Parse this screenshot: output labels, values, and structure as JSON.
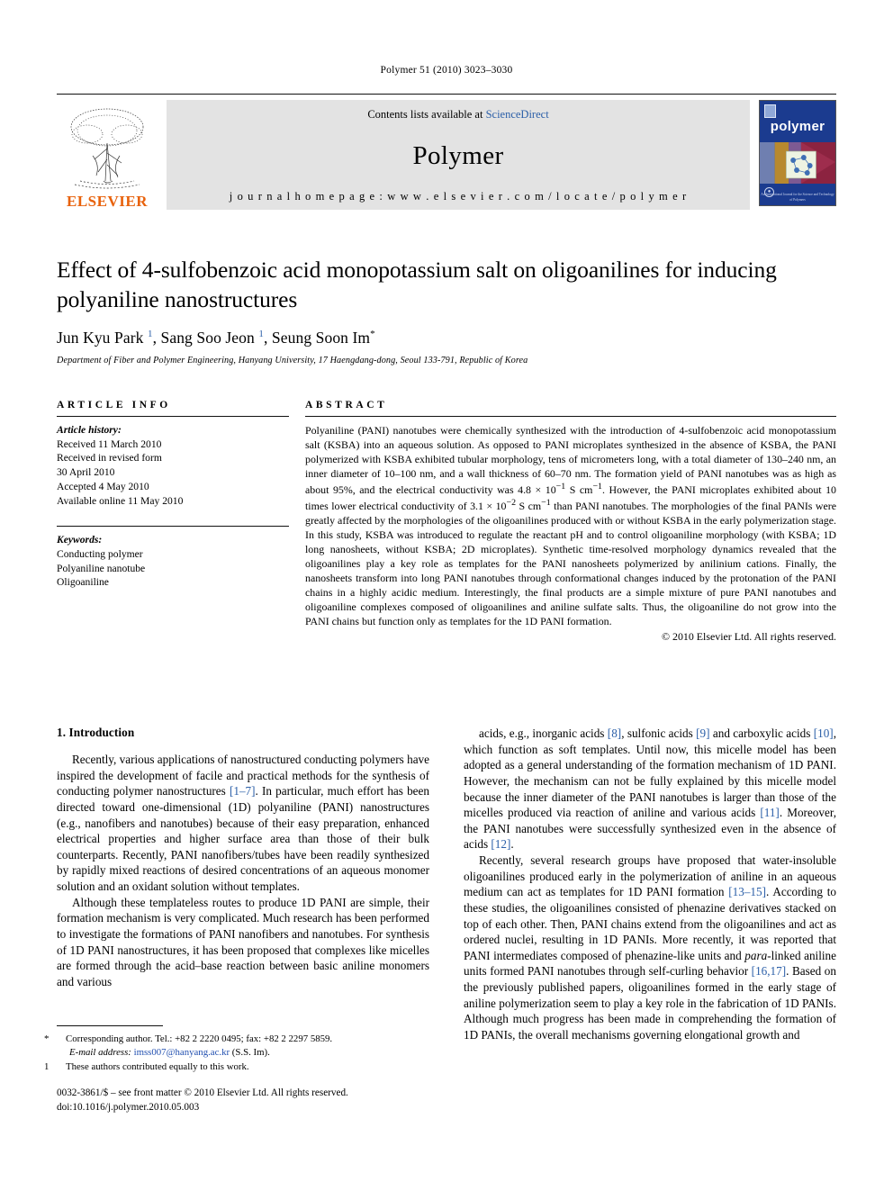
{
  "running_head": "Polymer 51 (2010) 3023–3030",
  "masthead": {
    "contents_prefix": "Contents lists available at ",
    "sciencedirect": "ScienceDirect",
    "journal_title": "Polymer",
    "homepage": "j o u r n a l   h o m e p a g e :   w w w . e l s e v i e r . c o m / l o c a t e / p o l y m e r",
    "publisher": "ELSEVIER",
    "cover_title": "polymer",
    "cover_footer": "An International Journal for the Science and Technology of Polymers",
    "accent_blue": "#2b5fa8",
    "elsevier_orange": "#E8620C",
    "cover_blue": "#1b3b8f"
  },
  "article": {
    "title": "Effect of 4-sulfobenzoic acid monopotassium salt on oligoanilines for inducing polyaniline nanostructures",
    "authors_html": "Jun Kyu Park <sup>1</sup>, Sang Soo Jeon <sup>1</sup>, Seung Soon Im<sup class=\"star\">*</sup>",
    "affiliation": "Department of Fiber and Polymer Engineering, Hanyang University, 17 Haengdang-dong, Seoul 133-791, Republic of Korea"
  },
  "info": {
    "heading": "ARTICLE INFO",
    "history_label": "Article history:",
    "history": [
      "Received 11 March 2010",
      "Received in revised form",
      "30 April 2010",
      "Accepted 4 May 2010",
      "Available online 11 May 2010"
    ],
    "keywords_label": "Keywords:",
    "keywords": [
      "Conducting polymer",
      "Polyaniline nanotube",
      "Oligoaniline"
    ]
  },
  "abstract": {
    "heading": "ABSTRACT",
    "text_html": "Polyaniline (PANI) nanotubes were chemically synthesized with the introduction of 4-sulfobenzoic acid monopotassium salt (KSBA) into an aqueous solution. As opposed to PANI microplates synthesized in the absence of KSBA, the PANI polymerized with KSBA exhibited tubular morphology, tens of micrometers long, with a total diameter of 130&#8211;240 nm, an inner diameter of 10&#8211;100 nm, and a wall thickness of 60&#8211;70 nm. The formation yield of PANI nanotubes was as high as about 95%, and the electrical conductivity was 4.8 &#215; 10<sup>&#8722;1</sup> S cm<sup>&#8722;1</sup>. However, the PANI microplates exhibited about 10 times lower electrical conductivity of 3.1 &#215; 10<sup>&#8722;2</sup> S cm<sup>&#8722;1</sup> than PANI nanotubes. The morphologies of the final PANIs were greatly affected by the morphologies of the oligoanilines produced with or without KSBA in the early polymerization stage. In this study, KSBA was introduced to regulate the reactant pH and to control oligoaniline morphology (with KSBA; 1D long nanosheets, without KSBA; 2D microplates). Synthetic time-resolved morphology dynamics revealed that the oligoanilines play a key role as templates for the PANI nanosheets polymerized by anilinium cations. Finally, the nanosheets transform into long PANI nanotubes through conformational changes induced by the protonation of the PANI chains in a highly acidic medium. Interestingly, the final products are a simple mixture of pure PANI nanotubes and oligoaniline complexes composed of oligoanilines and aniline sulfate salts. Thus, the oligoaniline do not grow into the PANI chains but function only as templates for the 1D PANI formation.",
    "copyright": "© 2010 Elsevier Ltd. All rights reserved."
  },
  "body": {
    "section_number_title": "1. Introduction",
    "left_paragraphs_html": [
      "Recently, various applications of nanostructured conducting polymers have inspired the development of facile and practical methods for the synthesis of conducting polymer nanostructures <span class=\"cit\">[1&#8211;7]</span>. In particular, much effort has been directed toward one-dimensional (1D) polyaniline (PANI) nanostructures (e.g., nanofibers and nanotubes) because of their easy preparation, enhanced electrical properties and higher surface area than those of their bulk counterparts. Recently, PANI nanofibers/tubes have been readily synthesized by rapidly mixed reactions of desired concentrations of an aqueous monomer solution and an oxidant solution without templates.",
      "Although these templateless routes to produce 1D PANI are simple, their formation mechanism is very complicated. Much research has been performed to investigate the formations of PANI nanofibers and nanotubes. For synthesis of 1D PANI nanostructures, it has been proposed that complexes like micelles are formed through the acid&#8211;base reaction between basic aniline monomers and various"
    ],
    "right_paragraphs_html": [
      "acids, e.g., inorganic acids <span class=\"cit\">[8]</span>, sulfonic acids <span class=\"cit\">[9]</span> and carboxylic acids <span class=\"cit\">[10]</span>, which function as soft templates. Until now, this micelle model has been adopted as a general understanding of the formation mechanism of 1D PANI. However, the mechanism can not be fully explained by this micelle model because the inner diameter of the PANI nanotubes is larger than those of the micelles produced via reaction of aniline and various acids <span class=\"cit\">[11]</span>. Moreover, the PANI nanotubes were successfully synthesized even in the absence of acids <span class=\"cit\">[12]</span>.",
      "Recently, several research groups have proposed that water-insoluble oligoanilines produced early in the polymerization of aniline in an aqueous medium can act as templates for 1D PANI formation <span class=\"cit\">[13&#8211;15]</span>. According to these studies, the oligoanilines consisted of phenazine derivatives stacked on top of each other. Then, PANI chains extend from the oligoanilines and act as ordered nuclei, resulting in 1D PANIs. More recently, it was reported that PANI intermediates composed of phenazine-like units and <i>para</i>-linked aniline units formed PANI nanotubes through self-curling behavior <span class=\"cit\">[16,17]</span>. Based on the previously published papers, oligoanilines formed in the early stage of aniline polymerization seem to play a key role in the fabrication of 1D PANIs. Although much progress has been made in comprehending the formation of 1D PANIs, the overall mechanisms governing elongational growth and"
    ]
  },
  "footnotes": {
    "corresponding_html": "<span class=\"mark\">*</span>Corresponding author. Tel.: +82 2 2220 0495; fax: +82 2 2297 5859.",
    "email_label": "E-mail address:",
    "email": "imss007@hanyang.ac.kr",
    "email_suffix": "(S.S. Im).",
    "equal_contrib_html": "<span class=\"mark\">1</span>These authors contributed equally to this work."
  },
  "footer": {
    "issn_line": "0032-3861/$ – see front matter © 2010 Elsevier Ltd. All rights reserved.",
    "doi_line": "doi:10.1016/j.polymer.2010.05.003"
  }
}
